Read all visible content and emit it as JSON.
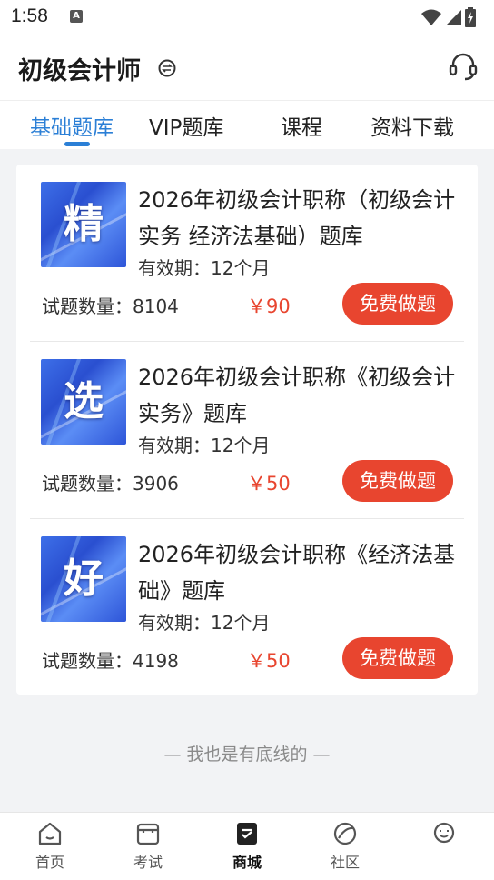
{
  "status_bar": {
    "time": "1:58"
  },
  "header": {
    "title": "初级会计师"
  },
  "tabs": [
    {
      "label": "基础题库",
      "active": true
    },
    {
      "label": "VIP题库",
      "active": false
    },
    {
      "label": "课程",
      "active": false
    },
    {
      "label": "资料下载",
      "active": false
    }
  ],
  "products": [
    {
      "cover_char": "精",
      "title": "2026年初级会计职称（初级会计实务 经济法基础）题库",
      "validity": "有效期：12个月",
      "count": "试题数量：8104",
      "price": "￥90",
      "button": "免费做题"
    },
    {
      "cover_char": "选",
      "title": "2026年初级会计职称《初级会计实务》题库",
      "validity": "有效期：12个月",
      "count": "试题数量：3906",
      "price": "￥50",
      "button": "免费做题"
    },
    {
      "cover_char": "好",
      "title": "2026年初级会计职称《经济法基础》题库",
      "validity": "有效期：12个月",
      "count": "试题数量：4198",
      "price": "￥50",
      "button": "免费做题"
    }
  ],
  "footer_text": "— 我也是有底线的 —",
  "bottom_nav": [
    {
      "label": "首页",
      "icon": "home-icon"
    },
    {
      "label": "考试",
      "icon": "exam-icon"
    },
    {
      "label": "商城",
      "icon": "mall-icon",
      "active": true
    },
    {
      "label": "社区",
      "icon": "community-icon"
    },
    {
      "label": "",
      "icon": "profile-icon"
    }
  ],
  "colors": {
    "accent": "#2b7fd6",
    "price": "#e8452f",
    "button": "#e8452f"
  }
}
